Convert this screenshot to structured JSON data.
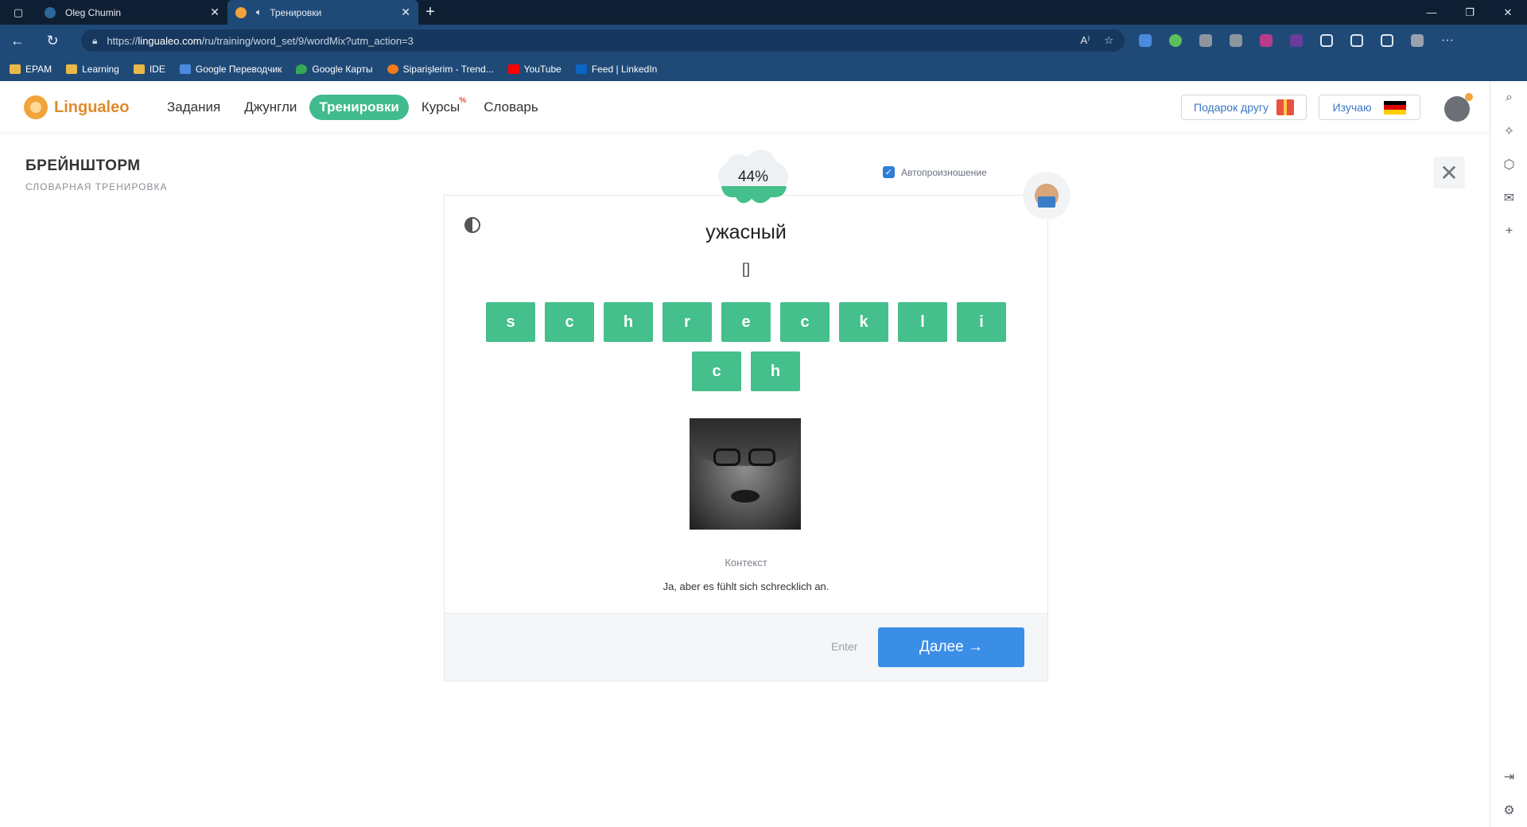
{
  "browser": {
    "tabs": [
      {
        "title": "Oleg Chumin"
      },
      {
        "title": "Тренировки"
      }
    ],
    "url_prefix": "https://",
    "url_host": "lingualeo.com",
    "url_path": "/ru/training/word_set/9/wordMix?utm_action=3",
    "bookmarks": [
      "EPAM",
      "Learning",
      "IDE",
      "Google Переводчик",
      "Google Карты",
      "Siparişlerim - Trend...",
      "YouTube",
      "Feed | LinkedIn"
    ]
  },
  "site": {
    "logo": "Lingualeo",
    "nav": [
      "Задания",
      "Джунгли",
      "Тренировки",
      "Курсы",
      "Словарь"
    ],
    "nav_badge": "%",
    "gift_label": "Подарок другу",
    "learn_label": "Изучаю",
    "flag_colors": [
      "#000000",
      "#dd0000",
      "#ffce00"
    ]
  },
  "page": {
    "title": "БРЕЙНШТОРМ",
    "subtitle": "СЛОВАРНАЯ ТРЕНИРОВКА",
    "progress": "44%",
    "autopronounce_label": "Автопроизношение",
    "word": "ужасный",
    "answer_placeholder": "[]",
    "letters": [
      "s",
      "c",
      "h",
      "r",
      "e",
      "c",
      "k",
      "l",
      "i",
      "c",
      "h"
    ],
    "context_label": "Контекст",
    "context_text": "Ja, aber es fühlt sich schrecklich an.",
    "enter_hint": "Enter",
    "next_label": "Далее →"
  },
  "colors": {
    "accent_green": "#45bf8c",
    "nav_active": "#40bb8d",
    "button_blue": "#3a8ee6",
    "logo_orange": "#e08a2a"
  }
}
